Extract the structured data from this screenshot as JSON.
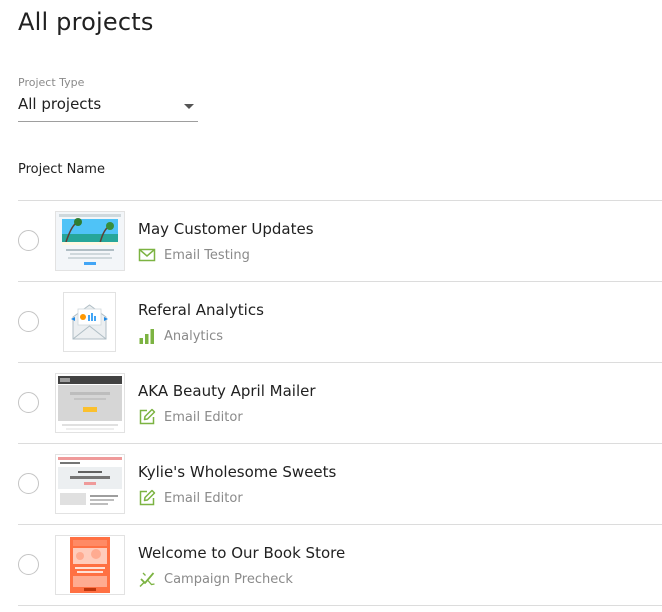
{
  "header": {
    "title": "All projects"
  },
  "filter": {
    "label": "Project Type",
    "value": "All projects"
  },
  "table": {
    "column_header": "Project Name"
  },
  "projects": [
    {
      "name": "May Customer Updates",
      "type": "Email Testing",
      "type_icon": "envelope-icon",
      "thumbnail": "beach-email-thumbnail"
    },
    {
      "name": "Referal Analytics",
      "type": "Analytics",
      "type_icon": "bar-chart-icon",
      "thumbnail": "analytics-envelope-thumbnail"
    },
    {
      "name": "AKA Beauty April Mailer",
      "type": "Email Editor",
      "type_icon": "edit-icon",
      "thumbnail": "gray-email-thumbnail"
    },
    {
      "name": "Kylie's Wholesome Sweets",
      "type": "Email Editor",
      "type_icon": "edit-icon",
      "thumbnail": "sweets-email-thumbnail"
    },
    {
      "name": "Welcome to Our Book Store",
      "type": "Campaign Precheck",
      "type_icon": "precheck-icon",
      "thumbnail": "orange-email-thumbnail"
    }
  ],
  "colors": {
    "icon_green": "#7cb342",
    "divider": "#dcdcdc",
    "text_secondary": "#8a8a8a"
  }
}
